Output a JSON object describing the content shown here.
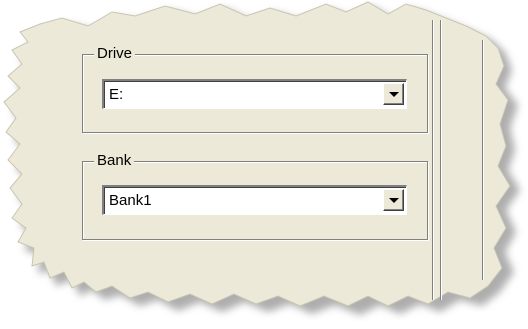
{
  "drive": {
    "legend": "Drive",
    "value": "E:"
  },
  "bank": {
    "legend": "Bank",
    "value": "Bank1"
  },
  "colors": {
    "panel": "#ece9d8",
    "shadow": "#a8a8a8"
  }
}
